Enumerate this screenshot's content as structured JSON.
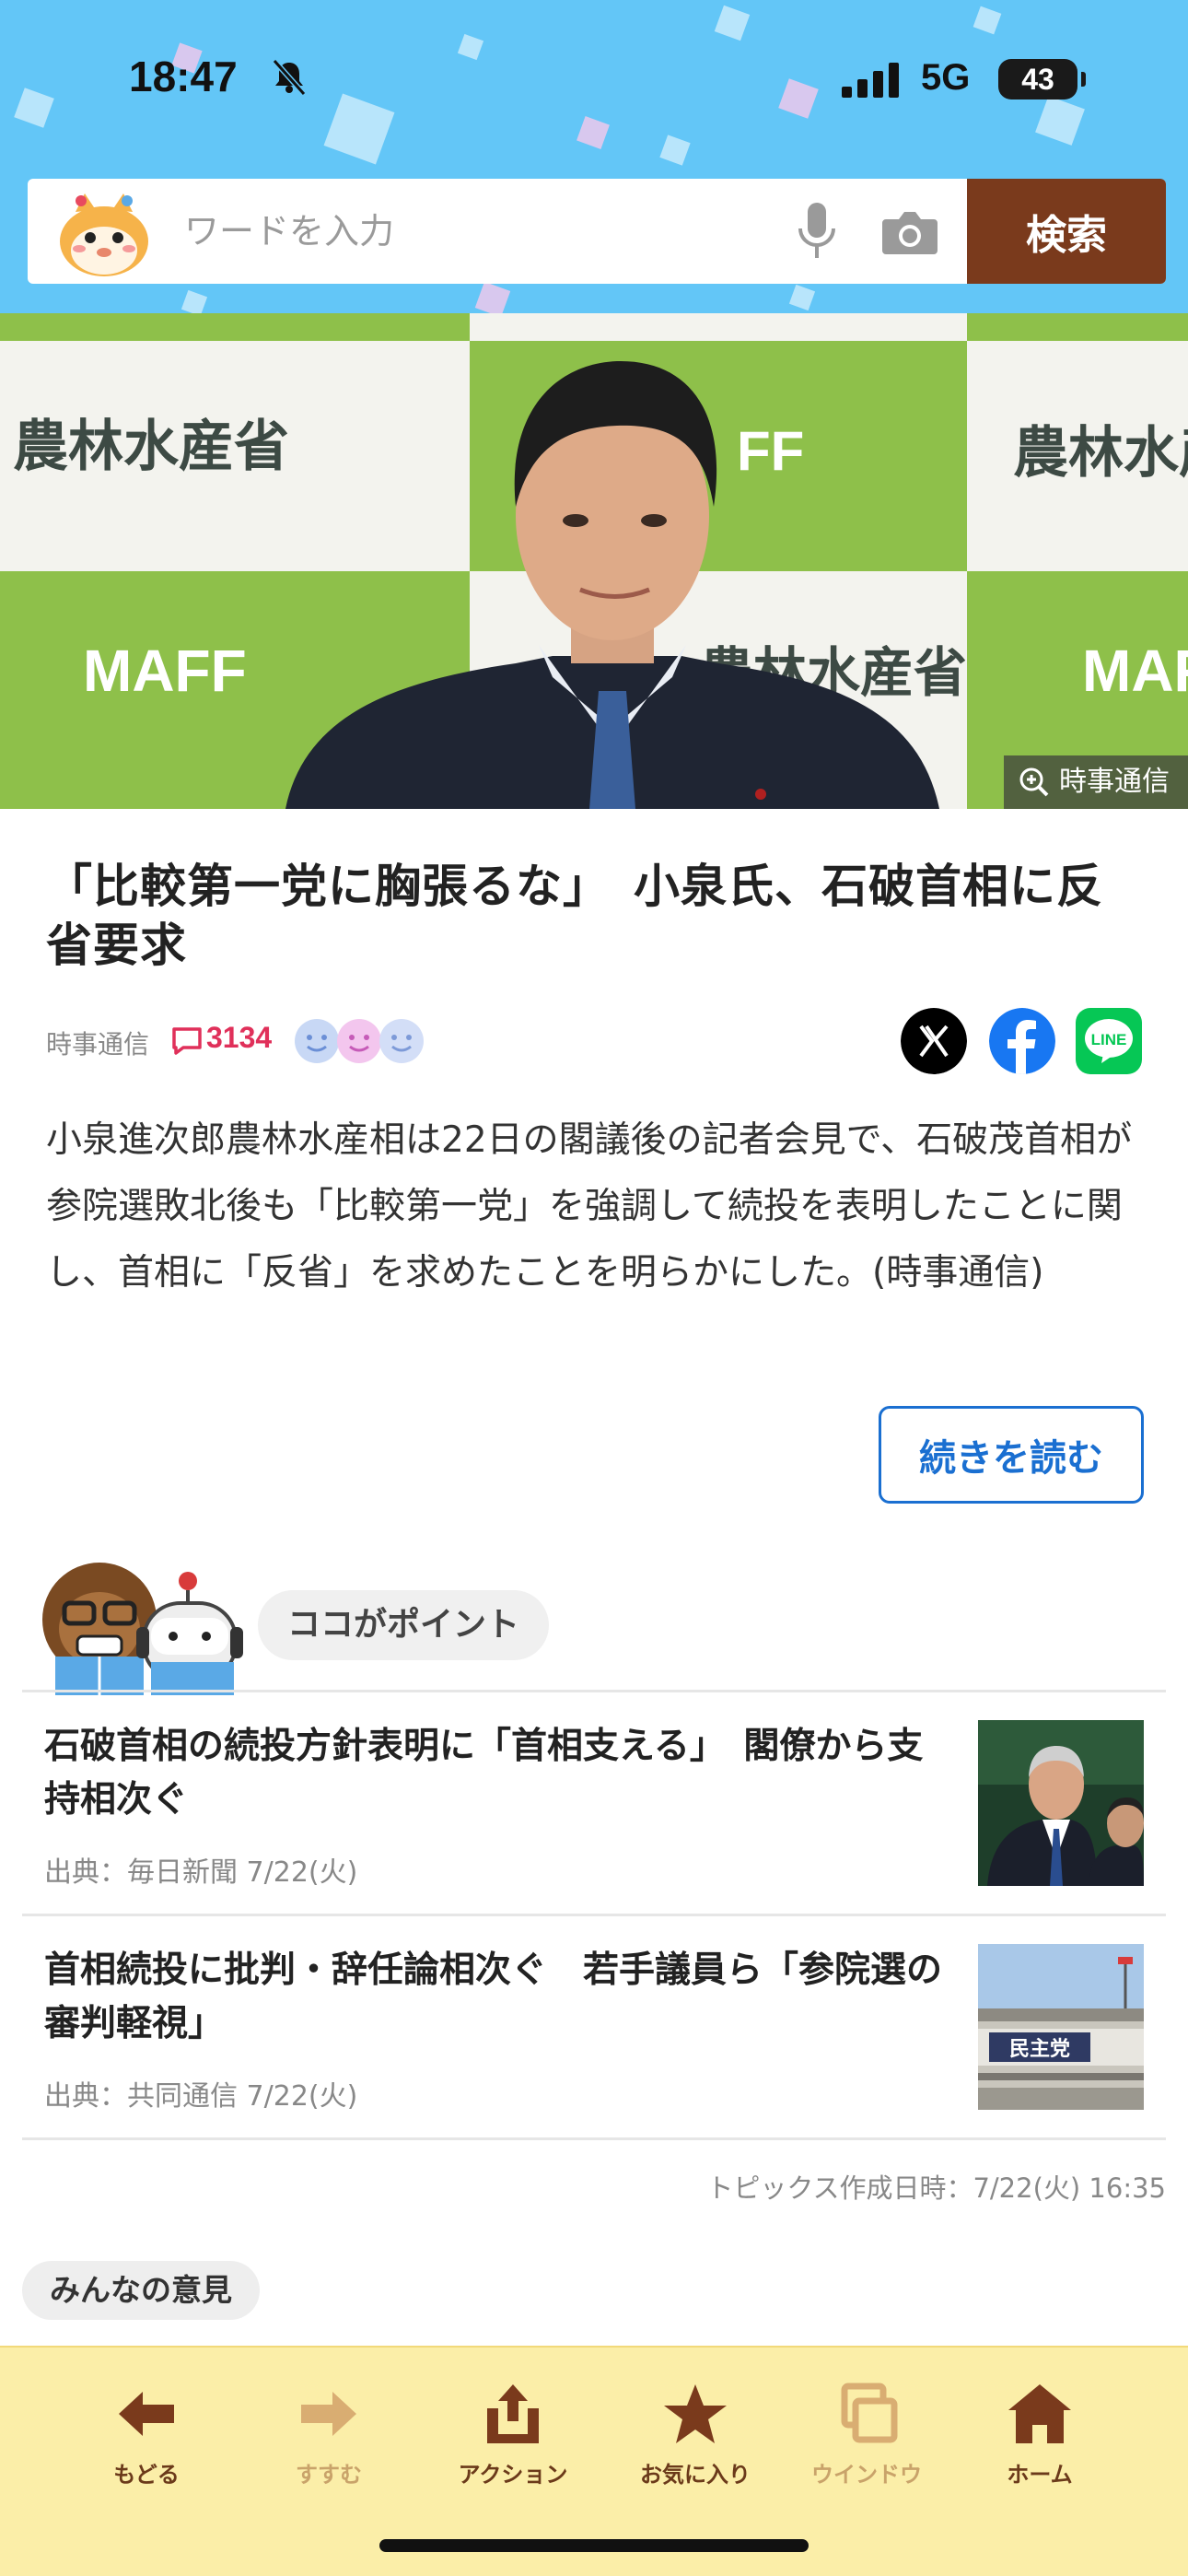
{
  "status_bar": {
    "time": "18:47",
    "network": "5G",
    "battery": "43"
  },
  "search": {
    "placeholder": "ワードを入力",
    "button_label": "検索"
  },
  "hero": {
    "photo_credit": "時事通信",
    "sign_text": "農林水産省",
    "logo_text": "MAFF"
  },
  "article": {
    "title": "「比較第一党に胸張るな」　小泉氏、石破首相に反省要求",
    "source": "時事通信",
    "comment_count": "3134",
    "body": "小泉進次郎農林水産相は22日の閣議後の記者会見で、石破茂首相が参院選敗北後も「比較第一党」を強調して続投を表明したことに関し、首相に「反省」を求めたことを明らかにした。(時事通信)",
    "read_more_label": "続きを読む"
  },
  "point_section": {
    "label": "ココがポイント",
    "items": [
      {
        "title": "石破首相の続投方針表明に「首相支える」　閣僚から支持相次ぐ",
        "source": "出典：毎日新聞 7/22(火)"
      },
      {
        "title": "首相続投に批判・辞任論相次ぐ　若手議員ら「参院選の審判軽視」",
        "source": "出典：共同通信 7/22(火)"
      }
    ],
    "thumb2_sign": "民主党",
    "topics_created": "トピックス作成日時：7/22(火) 16:35"
  },
  "opinion_label": "みんなの意見",
  "toolbar": {
    "items": [
      {
        "label": "もどる",
        "icon": "arrow-left-icon",
        "enabled": true
      },
      {
        "label": "すすむ",
        "icon": "arrow-right-icon",
        "enabled": false
      },
      {
        "label": "アクション",
        "icon": "share-icon",
        "enabled": true
      },
      {
        "label": "お気に入り",
        "icon": "star-icon",
        "enabled": true
      },
      {
        "label": "ウインドウ",
        "icon": "windows-icon",
        "enabled": false
      },
      {
        "label": "ホーム",
        "icon": "home-icon",
        "enabled": true
      }
    ]
  },
  "colors": {
    "header_bg": "#63c6f7",
    "search_button": "#7a3a1c",
    "link_blue": "#1a6fd1",
    "comment_red": "#e0305a",
    "toolbar_bg": "#fbeea8",
    "toolbar_label": "#6b3a1a"
  }
}
